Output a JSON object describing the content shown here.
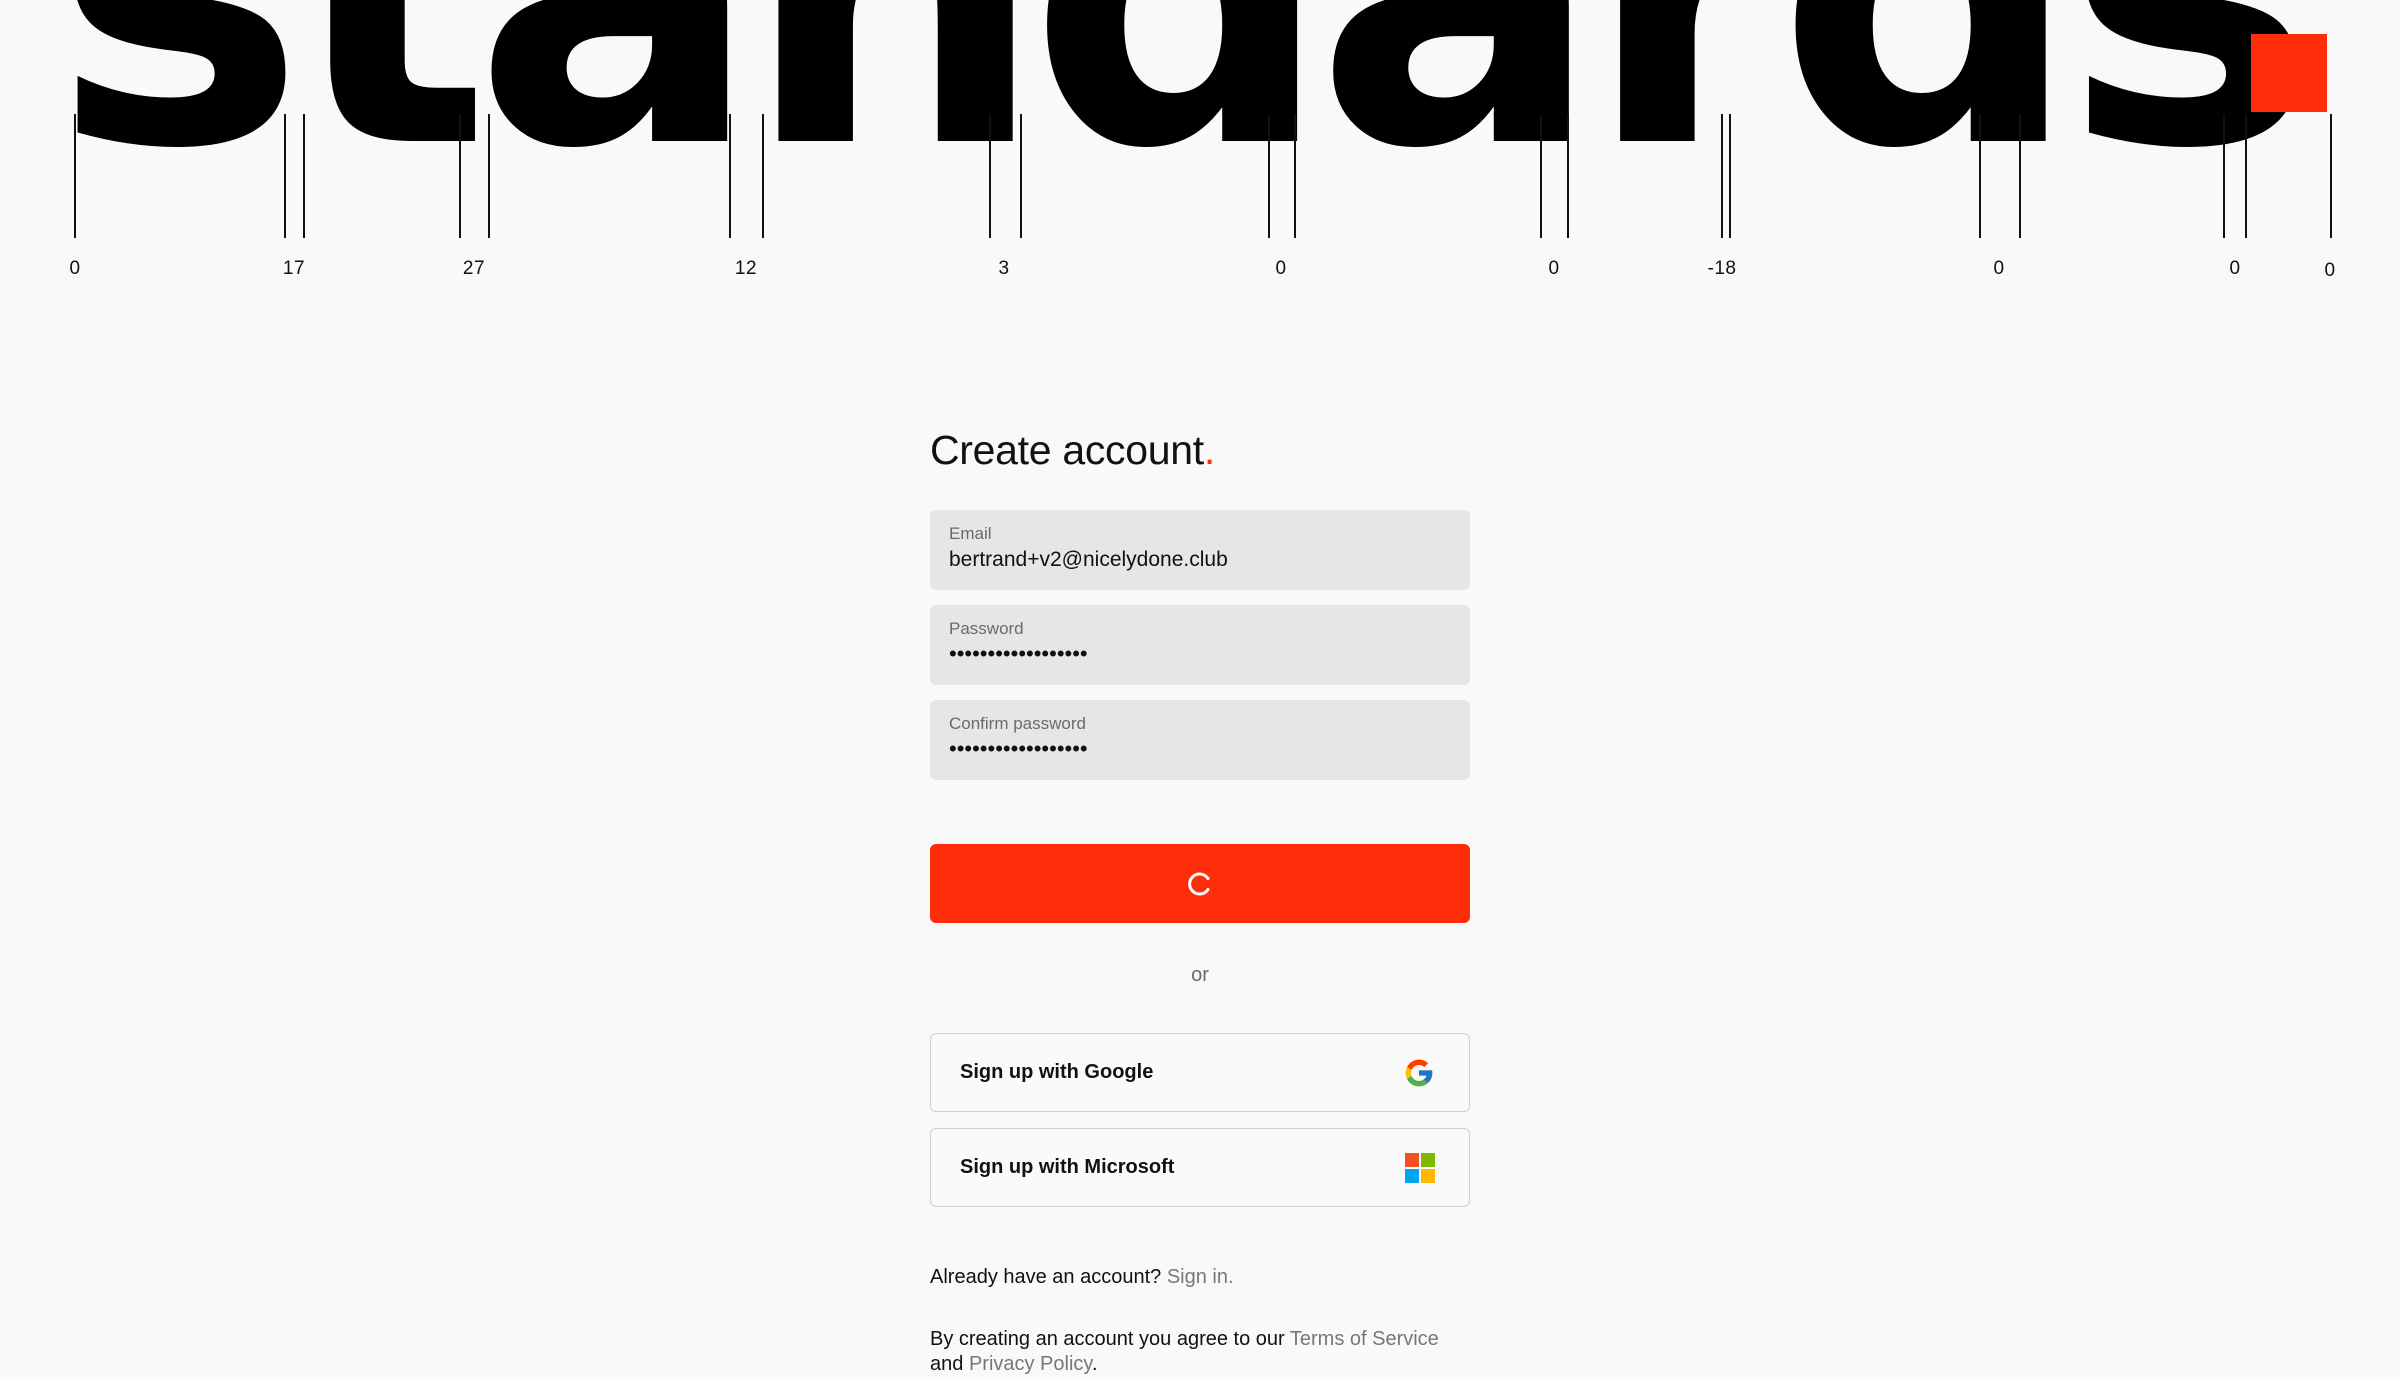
{
  "hero": {
    "word": "standards",
    "kerning_values": [
      "0",
      "17",
      "27",
      "12",
      "3",
      "0",
      "0",
      "-18",
      "0",
      "0",
      "0"
    ]
  },
  "form": {
    "title": "Create account",
    "title_dot": ".",
    "email": {
      "label": "Email",
      "value": "bertrand+v2@nicelydone.club"
    },
    "password": {
      "label": "Password",
      "value": "••••••••••••••••••"
    },
    "confirm_password": {
      "label": "Confirm password",
      "value": "••••••••••••••••••"
    },
    "submit": {
      "state": "loading",
      "icon": "spinner-icon"
    },
    "divider_text": "or",
    "google_button": {
      "label": "Sign up with Google",
      "icon": "google-icon"
    },
    "microsoft_button": {
      "label": "Sign up with Microsoft",
      "icon": "microsoft-icon"
    },
    "signin_prompt": "Already have an account?",
    "signin_link": "Sign in.",
    "terms_prefix": "By creating an account you agree to our",
    "terms_link": "Terms of Service",
    "terms_and": "and",
    "privacy_link": "Privacy Policy",
    "terms_end": "."
  },
  "colors": {
    "accent": "#ff2d0a",
    "background": "#f9f9f9",
    "field_background": "#e6e6e6",
    "muted_text": "#777777"
  }
}
